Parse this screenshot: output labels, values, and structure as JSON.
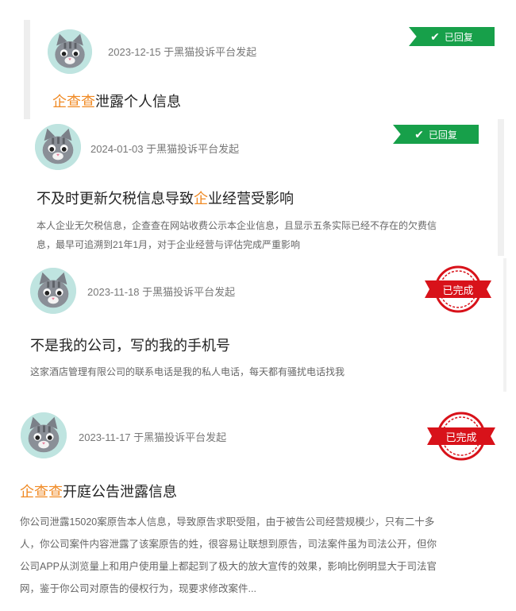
{
  "complaints": [
    {
      "date": "2023-12-15",
      "platform": "于黑猫投诉平台发起",
      "status": "已回复",
      "title_hl": "企查查",
      "title_rest": "泄露个人信息",
      "desc": ""
    },
    {
      "date": "2024-01-03",
      "platform": "于黑猫投诉平台发起",
      "status": "已回复",
      "title_a": "不及时更新欠税信息导致",
      "title_hl": "企",
      "title_b": "业经营受影响",
      "desc_line1": "本人企业无欠税信息，企查查在网站收费公示本企业信息，且显示五条实际已经不存在的欠费信",
      "desc_line2": "息，最早可追溯到21年1月，对于企业经营与评估完成严重影响"
    },
    {
      "date": "2023-11-18",
      "platform": "于黑猫投诉平台发起",
      "status": "已完成",
      "title": "不是我的公司，写的我的手机号",
      "desc": "这家酒店管理有限公司的联系电话是我的私人电话，每天都有骚扰电话找我"
    },
    {
      "date": "2023-11-17",
      "platform": "于黑猫投诉平台发起",
      "status": "已完成",
      "title_hl": "企查查",
      "title_rest": "开庭公告泄露信息",
      "desc_lines": [
        "你公司泄露15020案原告本人信息，导致原告求职受阻，由于被告公司经营规模少，只有二十多",
        "人，你公司案件内容泄露了该案原告的姓，很容易让联想到原告，司法案件虽为司法公开，但你",
        "公司APP从浏览量上和用户使用量上都起到了极大的放大宣传的效果，影响比例明显大于司法官",
        "网，鉴于你公司对原告的侵权行为，现要求修改案件..."
      ]
    }
  ],
  "colors": {
    "accent": "#f08a24",
    "replied": "#17a04a",
    "completed": "#d8121a"
  },
  "icons": {
    "avatar": "cat-avatar-icon",
    "replied": "check-icon",
    "completed": "stamp-icon"
  }
}
